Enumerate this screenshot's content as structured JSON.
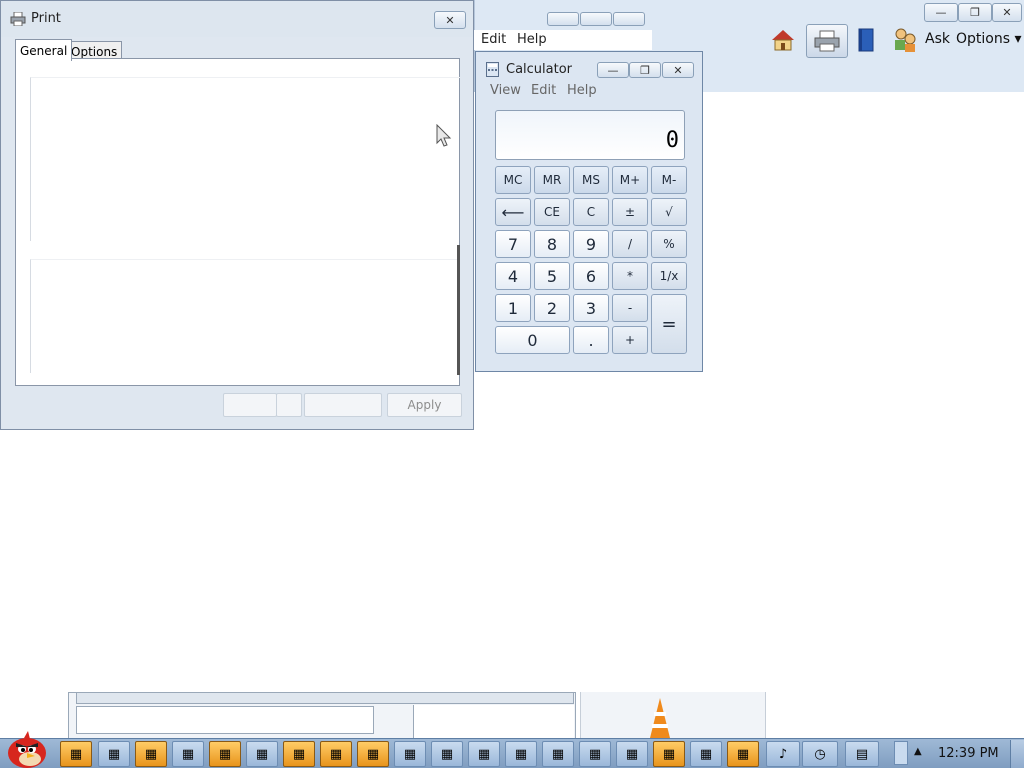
{
  "background_window": {
    "menu": [
      "Edit",
      "Help"
    ],
    "toolbar": {
      "ask_label": "Ask",
      "options_label": "Options",
      "icons": [
        "home-icon",
        "print-icon",
        "book-icon",
        "people-icon"
      ]
    },
    "controls": {
      "minimize": "—",
      "restore": "❐",
      "close": "✕"
    }
  },
  "print_dialog": {
    "title": "Print",
    "tabs": [
      "General",
      "Options"
    ],
    "apply_label": "Apply",
    "close_glyph": "✕"
  },
  "calculator": {
    "title": "Calculator",
    "menu": [
      "View",
      "Edit",
      "Help"
    ],
    "display": "0",
    "memory_keys": [
      "MC",
      "MR",
      "MS",
      "M+",
      "M-"
    ],
    "row1": [
      "⟵",
      "CE",
      "C",
      "±",
      "√"
    ],
    "row2": [
      "7",
      "8",
      "9",
      "/",
      "%"
    ],
    "row3": [
      "4",
      "5",
      "6",
      "*",
      "1/x"
    ],
    "row4": [
      "1",
      "2",
      "3",
      "-"
    ],
    "row5": [
      "0",
      ".",
      "+"
    ],
    "equals": "=",
    "controls": {
      "minimize": "—",
      "restore": "❐",
      "close": "✕"
    }
  },
  "taskbar": {
    "clock": "12:39 PM",
    "start_icon": "angry-bird-icon"
  },
  "colors": {
    "window_frame": "#dfe7f0",
    "taskbar": "#8fabcd",
    "taskbar_item": "#f0a830"
  }
}
